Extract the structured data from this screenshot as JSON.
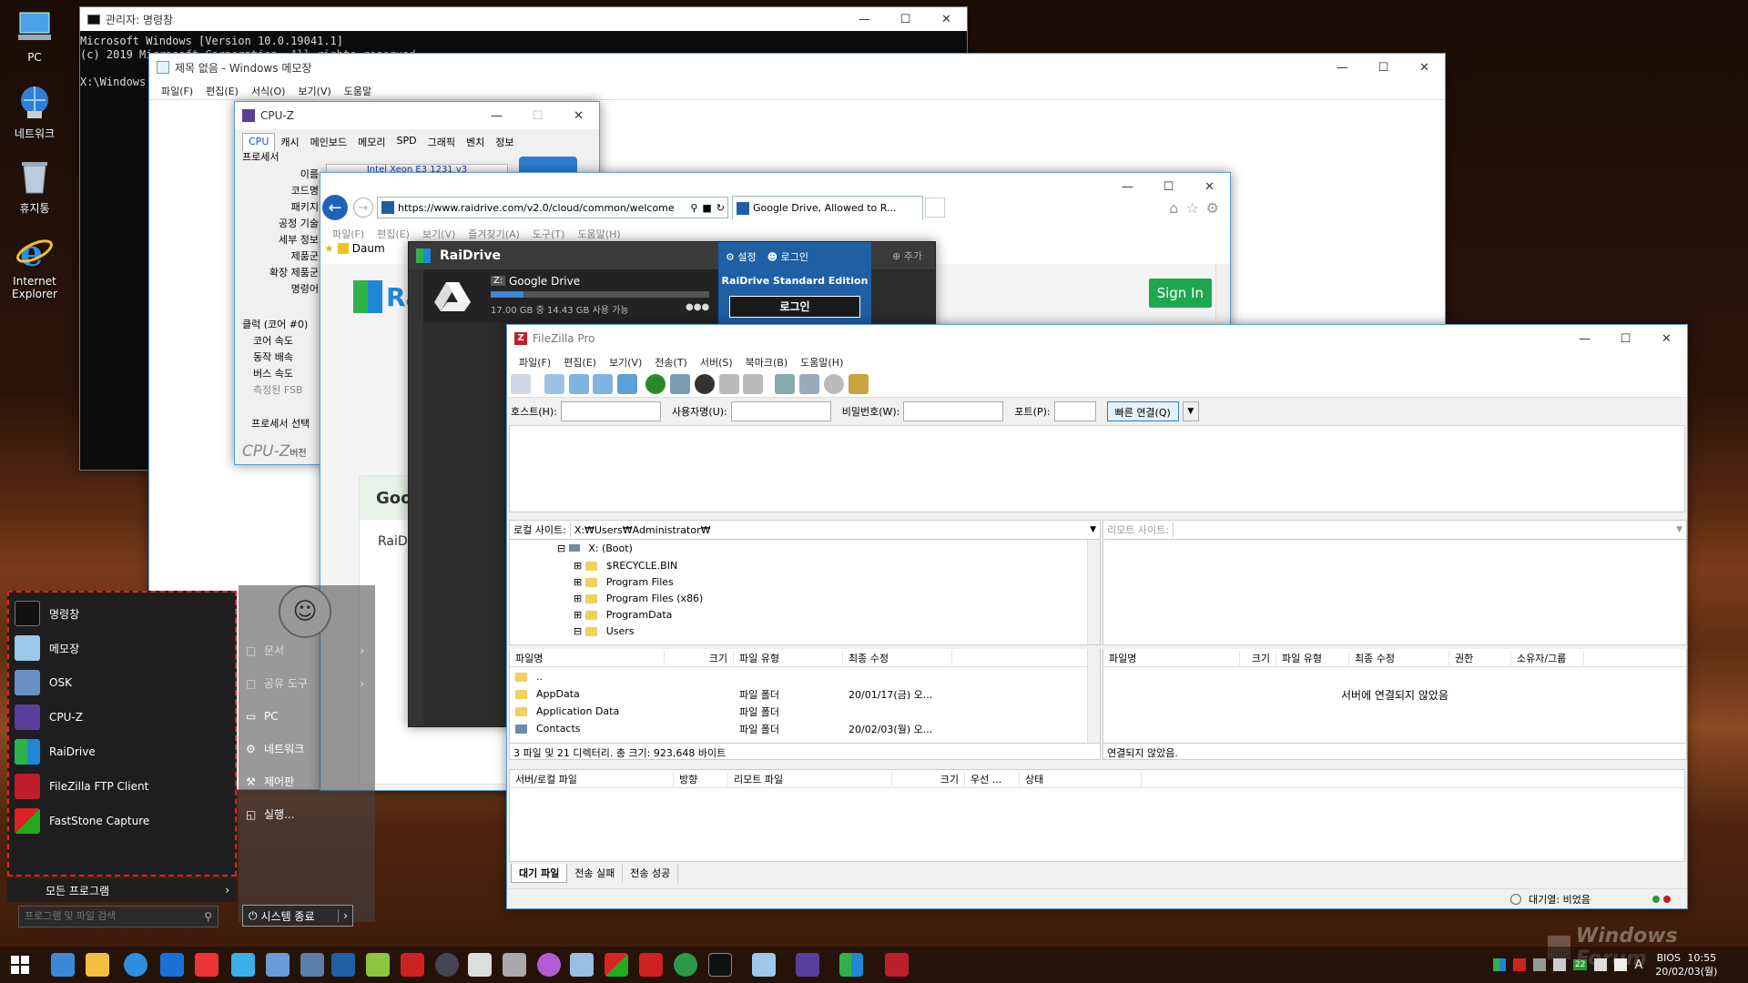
{
  "desktop": {
    "icons": [
      {
        "label": "PC"
      },
      {
        "label": "네트워크"
      },
      {
        "label": "휴지통"
      },
      {
        "label": "Internet Explorer"
      }
    ]
  },
  "cmd": {
    "title": "관리자: 명령창",
    "lines": [
      "Microsoft Windows [Version 10.0.19041.1]",
      "(c) 2019 Microsoft Corporation. All rights reserved.",
      "",
      "X:\\Windows"
    ]
  },
  "notepad": {
    "title": "제목 없음 - Windows 메모장",
    "menu": [
      "파일(F)",
      "편집(E)",
      "서식(O)",
      "보기(V)",
      "도움말"
    ]
  },
  "cpuz": {
    "title": "CPU-Z",
    "tabs": [
      "CPU",
      "캐시",
      "메인보드",
      "메모리",
      "SPD",
      "그래픽",
      "벤치",
      "정보"
    ],
    "group_processor": "프로세서",
    "labels": [
      "이름",
      "코드명",
      "패키지",
      "공정 기술",
      "세부 정보",
      "제품군",
      "확장 제품군",
      "명령어"
    ],
    "name_value": "Intel Xeon E3 1231 v3",
    "group_clock": "클럭 (코어 #0)",
    "clock_labels": [
      "코어 속도",
      "동작 배속",
      "버스 속도",
      "측정된 FSB"
    ],
    "select_label": "프로세서 선택",
    "footer": "CPU-Z",
    "footer_ver": "버전"
  },
  "browser": {
    "url": "https://www.raidrive.com/v2.0/cloud/common/welcome",
    "tab": "Google Drive, Allowed to R...",
    "menu": [
      "파일(F)",
      "편집(E)",
      "보기(V)",
      "즐겨찾기(A)",
      "도구(T)",
      "도움말(H)"
    ],
    "fav": "Daum",
    "sign_in": "Sign In",
    "logo": "Ra",
    "card_title": "Goo",
    "card_text": "RaiD"
  },
  "raidrive": {
    "title": "RaiDrive",
    "add": "추가",
    "settings": "설정",
    "login": "로그인",
    "drive_letter": "Z:",
    "drive_name": "Google Drive",
    "usage": "17.00 GB 중 14.43 GB 사용 가능",
    "usage_fraction": 0.15,
    "edition": "RaiDrive Standard Edition",
    "login_button": "로그인"
  },
  "filezilla": {
    "title": "FileZilla Pro",
    "menu": [
      "파일(F)",
      "편집(E)",
      "보기(V)",
      "전송(T)",
      "서버(S)",
      "북마크(B)",
      "도움말(H)"
    ],
    "host_label": "호스트(H):",
    "user_label": "사용자명(U):",
    "pass_label": "비밀번호(W):",
    "port_label": "포트(P):",
    "quick_connect": "빠른 연결(Q)",
    "local_label": "로컬 사이트:",
    "local_path": "X:₩Users₩Administrator₩",
    "remote_label": "리모트 사이트:",
    "tree": [
      {
        "name": "X: (Boot)"
      },
      {
        "name": "$RECYCLE.BIN"
      },
      {
        "name": "Program Files"
      },
      {
        "name": "Program Files (x86)"
      },
      {
        "name": "ProgramData"
      },
      {
        "name": "Users"
      }
    ],
    "local_headers": [
      "파일명",
      "크기",
      "파일 유형",
      "최종 수정"
    ],
    "local_files": [
      {
        "name": "..",
        "type": "",
        "date": ""
      },
      {
        "name": "AppData",
        "type": "파일 폴더",
        "date": "20/01/17(금) 오..."
      },
      {
        "name": "Application Data",
        "type": "파일 폴더",
        "date": ""
      },
      {
        "name": "Contacts",
        "type": "파일 폴더",
        "date": "20/02/03(월) 오..."
      }
    ],
    "remote_headers": [
      "파일명",
      "크기",
      "파일 유형",
      "최종 수정",
      "권한",
      "소유자/그룹"
    ],
    "not_connected": "서버에 연결되지 않았음",
    "local_status": "3 파일 및 21 디렉터리. 총 크기: 923,648 바이트",
    "remote_status": "연결되지 않았음.",
    "queue_headers": [
      "서버/로컬 파일",
      "방향",
      "리모트 파일",
      "크기",
      "우선 ...",
      "상태"
    ],
    "queue_tabs": [
      "대기 파일",
      "전송 실패",
      "전송 성공"
    ],
    "queue_status": "대기열: 비었음"
  },
  "startmenu": {
    "items": [
      "명령창",
      "메모장",
      "OSK",
      "CPU-Z",
      "RaiDrive",
      "FileZilla FTP Client",
      "FastStone Capture"
    ],
    "all_programs": "모든 프로그램",
    "search_placeholder": "프로그램 및 파일 검색",
    "right_items": [
      "문서",
      "공유 도구",
      "PC",
      "네트워크",
      "제어판",
      "실행..."
    ],
    "shutdown": "시스템 종료"
  },
  "taskbar": {
    "lang": "BIOS",
    "time": "10:55",
    "date": "20/02/03(월)",
    "ime": "A",
    "badge": "22"
  },
  "watermark": "Windows Forum",
  "colors": {
    "accent": "#2e8fd8",
    "raidrive_dark": "#2b2b2b",
    "raidrive_blue": "#1f5fa3",
    "signin": "#1fa74f",
    "startmenu_border": "#e0202a"
  }
}
